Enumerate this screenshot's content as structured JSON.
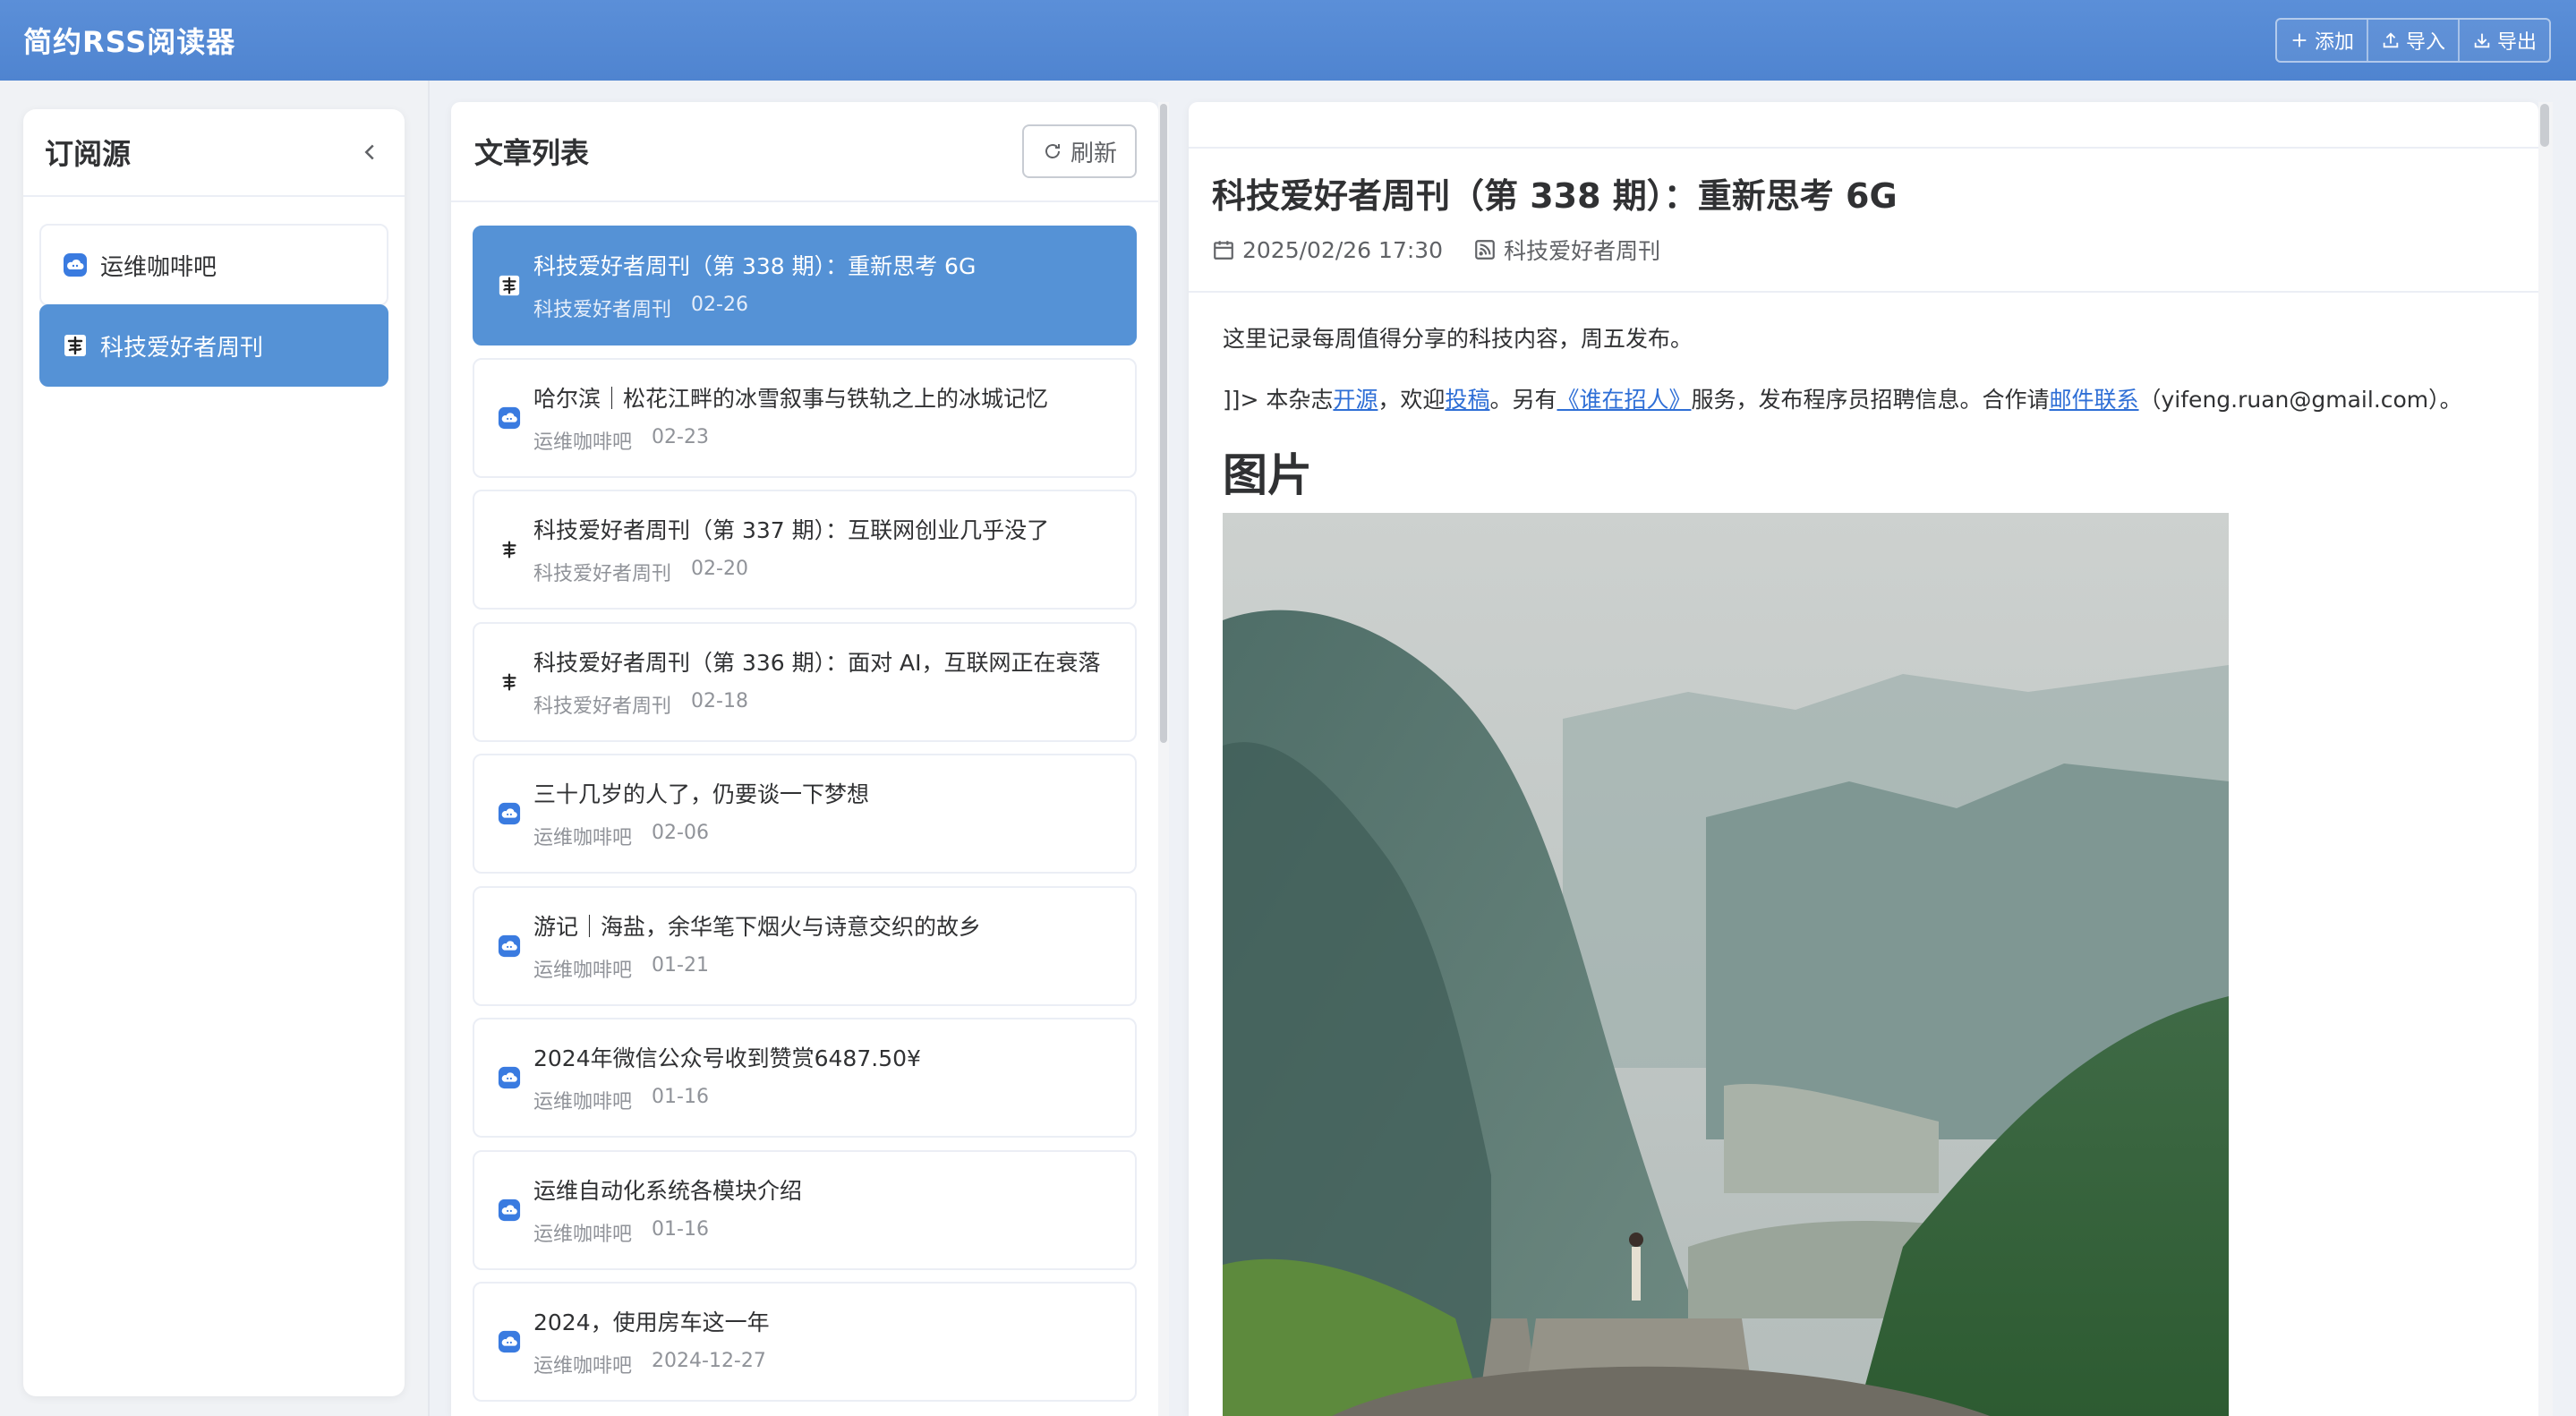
{
  "header": {
    "app_title": "简约RSS阅读器",
    "buttons": [
      {
        "label": "添加",
        "icon": "plus-icon"
      },
      {
        "label": "导入",
        "icon": "upload-icon"
      },
      {
        "label": "导出",
        "icon": "download-icon"
      }
    ]
  },
  "sidebar": {
    "title": "订阅源",
    "collapse_icon": "chevron-left-icon",
    "feeds": [
      {
        "label": "运维咖啡吧",
        "icon": "cloud-icon",
        "active": false
      },
      {
        "label": "科技爱好者周刊",
        "icon": "calligraphy-logo-icon",
        "active": true
      }
    ]
  },
  "article_list": {
    "title": "文章列表",
    "refresh_label": "刷新",
    "items": [
      {
        "title": "科技爱好者周刊（第 338 期）：重新思考 6G",
        "source": "科技爱好者周刊",
        "date": "02-26",
        "icon": "calligraphy-logo-icon",
        "active": true
      },
      {
        "title": "哈尔滨｜松花江畔的冰雪叙事与铁轨之上的冰城记忆",
        "source": "运维咖啡吧",
        "date": "02-23",
        "icon": "cloud-icon"
      },
      {
        "title": "科技爱好者周刊（第 337 期）：互联网创业几乎没了",
        "source": "科技爱好者周刊",
        "date": "02-20",
        "icon": "calligraphy-logo-icon"
      },
      {
        "title": "科技爱好者周刊（第 336 期）：面对 AI，互联网正在衰落",
        "source": "科技爱好者周刊",
        "date": "02-18",
        "icon": "calligraphy-logo-icon"
      },
      {
        "title": "三十几岁的人了，仍要谈一下梦想",
        "source": "运维咖啡吧",
        "date": "02-06",
        "icon": "cloud-icon"
      },
      {
        "title": "游记｜海盐，余华笔下烟火与诗意交织的故乡",
        "source": "运维咖啡吧",
        "date": "01-21",
        "icon": "cloud-icon"
      },
      {
        "title": "2024年微信公众号收到赞赏6487.50¥",
        "source": "运维咖啡吧",
        "date": "01-16",
        "icon": "cloud-icon"
      },
      {
        "title": "运维自动化系统各模块介绍",
        "source": "运维咖啡吧",
        "date": "01-16",
        "icon": "cloud-icon"
      },
      {
        "title": "2024，使用房车这一年",
        "source": "运维咖啡吧",
        "date": "2024-12-27",
        "icon": "cloud-icon"
      }
    ]
  },
  "reader": {
    "title": "科技爱好者周刊（第 338 期）：重新思考 6G",
    "datetime": "2025/02/26 17:30",
    "source": "科技爱好者周刊",
    "paragraph1": "这里记录每周值得分享的科技内容，周五发布。",
    "paragraph2": {
      "t1": "]]> 本杂志",
      "link1": "开源",
      "t2": "，欢迎",
      "link2": "投稿",
      "t3": "。另有",
      "link3": "《谁在招人》",
      "t4": "服务，发布程序员招聘信息。合作请",
      "link4": "邮件联系",
      "t5": "（yifeng.ruan@gmail.com）。"
    },
    "heading": "图片",
    "image_alt": "mountain-valley-photo"
  },
  "colors": {
    "header": "#5b8fd8",
    "active": "#5592d6",
    "link": "#2f6fd6",
    "feed_cloud_icon": "#3a7be0"
  }
}
